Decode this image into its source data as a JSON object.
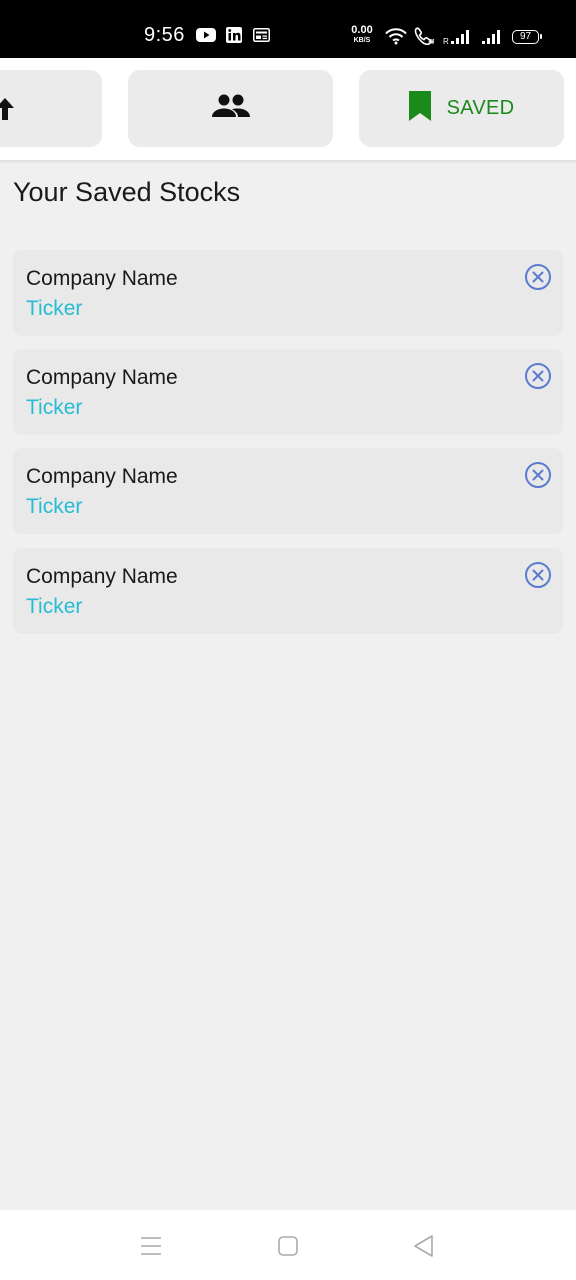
{
  "status_bar": {
    "time": "9:56",
    "net_speed_value": "0.00",
    "net_speed_unit": "KB/S",
    "battery": "97",
    "icons": [
      "youtube-icon",
      "linkedin-icon",
      "news-icon",
      "wifi-icon",
      "wifi-call-icon",
      "signal-roaming-icon",
      "signal-icon"
    ]
  },
  "nav": {
    "home_icon": "home-arrow-icon",
    "community_icon": "people-icon",
    "saved_icon": "bookmark-icon",
    "saved_label": "SAVED"
  },
  "page": {
    "title": "Your Saved Stocks"
  },
  "stocks": [
    {
      "company": "Company Name",
      "ticker": "Ticker"
    },
    {
      "company": "Company Name",
      "ticker": "Ticker"
    },
    {
      "company": "Company Name",
      "ticker": "Ticker"
    },
    {
      "company": "Company Name",
      "ticker": "Ticker"
    }
  ],
  "colors": {
    "accent_saved": "#1a8a1a",
    "ticker": "#26bcd3",
    "remove_icon": "#5b7bd0"
  },
  "bottom_nav": [
    "menu-icon",
    "home-square-icon",
    "back-triangle-icon"
  ]
}
